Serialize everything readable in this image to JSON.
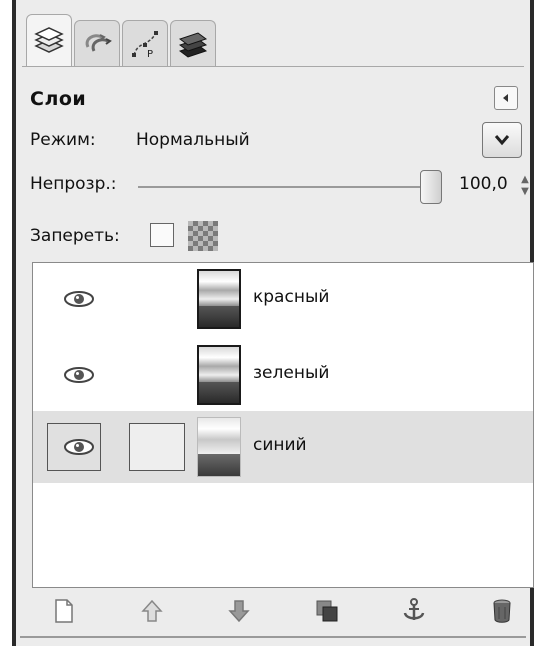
{
  "panel": {
    "title": "Слои",
    "tabs": [
      {
        "name": "layers-tab-icon",
        "active": true
      },
      {
        "name": "undo-history-tab-icon",
        "active": false
      },
      {
        "name": "paths-tab-icon",
        "active": false
      },
      {
        "name": "channels-tab-icon",
        "active": false
      }
    ]
  },
  "mode": {
    "label": "Режим:",
    "value": "Нормальный"
  },
  "opacity": {
    "label": "Непрозр.:",
    "value": "100,0",
    "fraction": 1.0
  },
  "lock": {
    "label": "Запереть:"
  },
  "layers": [
    {
      "name": "красный",
      "visible": true,
      "selected": false
    },
    {
      "name": "зеленый",
      "visible": true,
      "selected": false
    },
    {
      "name": "синий",
      "visible": true,
      "selected": true
    }
  ],
  "toolbar_icons": [
    "new-layer-icon",
    "raise-layer-icon",
    "lower-layer-icon",
    "duplicate-layer-icon",
    "anchor-layer-icon",
    "delete-layer-icon"
  ]
}
